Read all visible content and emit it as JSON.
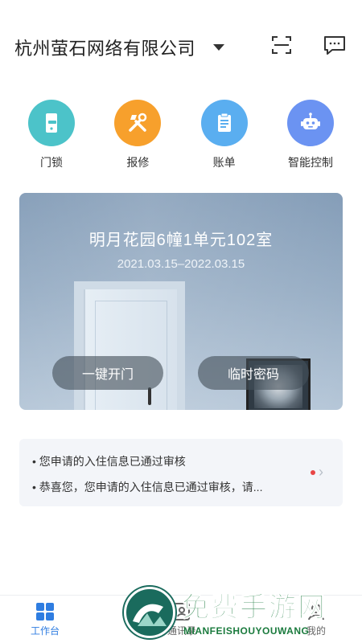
{
  "header": {
    "company": "杭州萤石网络有限公司",
    "scan_icon": "scan-icon",
    "message_icon": "message-icon"
  },
  "quick_actions": [
    {
      "label": "门锁",
      "icon": "door-lock-icon",
      "color": "#4cc3c9"
    },
    {
      "label": "报修",
      "icon": "repair-tools-icon",
      "color": "#f7a02c"
    },
    {
      "label": "账单",
      "icon": "bill-icon",
      "color": "#5aaef0"
    },
    {
      "label": "智能控制",
      "icon": "robot-icon",
      "color": "#6b93f2"
    }
  ],
  "room_card": {
    "title": "明月花园6幢1单元102室",
    "date_range": "2021.03.15–2022.03.15",
    "unlock_button": "一键开门",
    "temp_password_button": "临时密码"
  },
  "notice": {
    "line1": "您申请的入住信息已通过审核",
    "line2": "恭喜您，您申请的入住信息已通过审核，请..."
  },
  "tabbar": {
    "work": "工作台",
    "contacts": "通讯录",
    "mine": "我的",
    "accent": "#2f7de1"
  },
  "watermark": {
    "big": "免费手游网",
    "small": "MIANFEISHOUYOUWANG"
  }
}
